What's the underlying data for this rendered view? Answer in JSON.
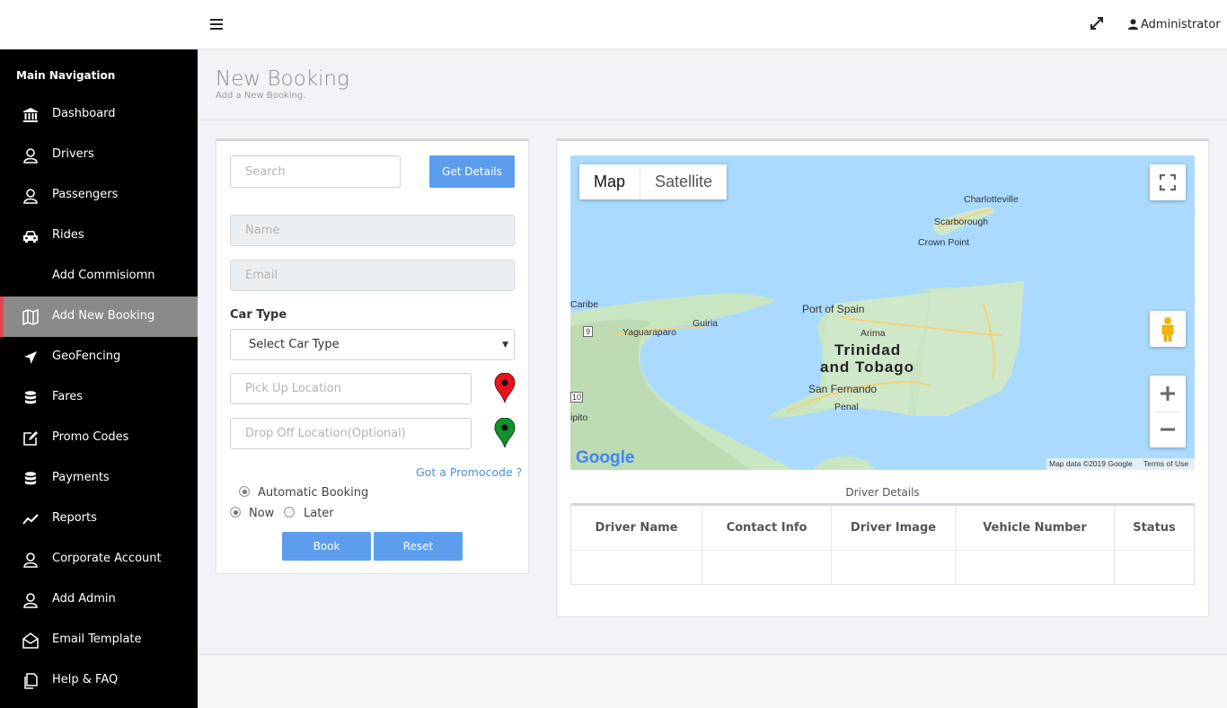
{
  "header": {
    "admin_label": "Administrator"
  },
  "sidebar": {
    "heading": "Main Navigation",
    "items": [
      {
        "label": "Dashboard",
        "icon": "bank-icon"
      },
      {
        "label": "Drivers",
        "icon": "user-icon"
      },
      {
        "label": "Passengers",
        "icon": "user-icon"
      },
      {
        "label": "Rides",
        "icon": "car-icon"
      },
      {
        "label": "Add Commisiomn",
        "icon": ""
      },
      {
        "label": "Add New Booking",
        "icon": "map-icon",
        "active": true
      },
      {
        "label": "GeoFencing",
        "icon": "location-arrow-icon"
      },
      {
        "label": "Fares",
        "icon": "database-icon"
      },
      {
        "label": "Promo Codes",
        "icon": "edit-icon"
      },
      {
        "label": "Payments",
        "icon": "database-icon"
      },
      {
        "label": "Reports",
        "icon": "line-chart-icon"
      },
      {
        "label": "Corporate Account",
        "icon": "user-icon"
      },
      {
        "label": "Add Admin",
        "icon": "user-icon"
      },
      {
        "label": "Email Template",
        "icon": "envelope-open-icon"
      },
      {
        "label": "Help & FAQ",
        "icon": "file-icon"
      }
    ]
  },
  "page": {
    "title": "New Booking",
    "subtitle": "Add a New Booking."
  },
  "form": {
    "search_placeholder": "Search",
    "get_details": "Get Details",
    "name_placeholder": "Name",
    "email_placeholder": "Email",
    "car_type_label": "Car Type",
    "car_type_selected": "Select Car Type",
    "pickup_placeholder": "Pick Up Location",
    "dropoff_placeholder": "Drop Off Location(Optional)",
    "promo_link": "Got a Promocode ?",
    "automatic_booking": "Automatic Booking",
    "now": "Now",
    "later": "Later",
    "book": "Book",
    "reset": "Reset",
    "pickup_pin_color": "#e8131b",
    "dropoff_pin_color": "#138f2e"
  },
  "map": {
    "map_tab": "Map",
    "satellite_tab": "Satellite",
    "labels": {
      "charlotteville": "Charlotteville",
      "scarborough": "Scarborough",
      "crown_point": "Crown Point",
      "port_of_spain": "Port of Spain",
      "arima": "Arima",
      "country1": "Trinidad",
      "country2": "and Tobago",
      "san_fernando": "San Fernando",
      "penal": "Penal",
      "guiria": "Guiria",
      "yaguaraparo": "Yaguaraparo",
      "caribe": "Caribe",
      "pipito": "ipito",
      "road9": "9",
      "road10": "10"
    },
    "attribution": "Map data ©2019 Google",
    "terms": "Terms of Use",
    "google": "Google"
  },
  "driver_details": {
    "title": "Driver Details",
    "columns": [
      "Driver Name",
      "Contact Info",
      "Driver Image",
      "Vehicle Number",
      "Status"
    ]
  }
}
